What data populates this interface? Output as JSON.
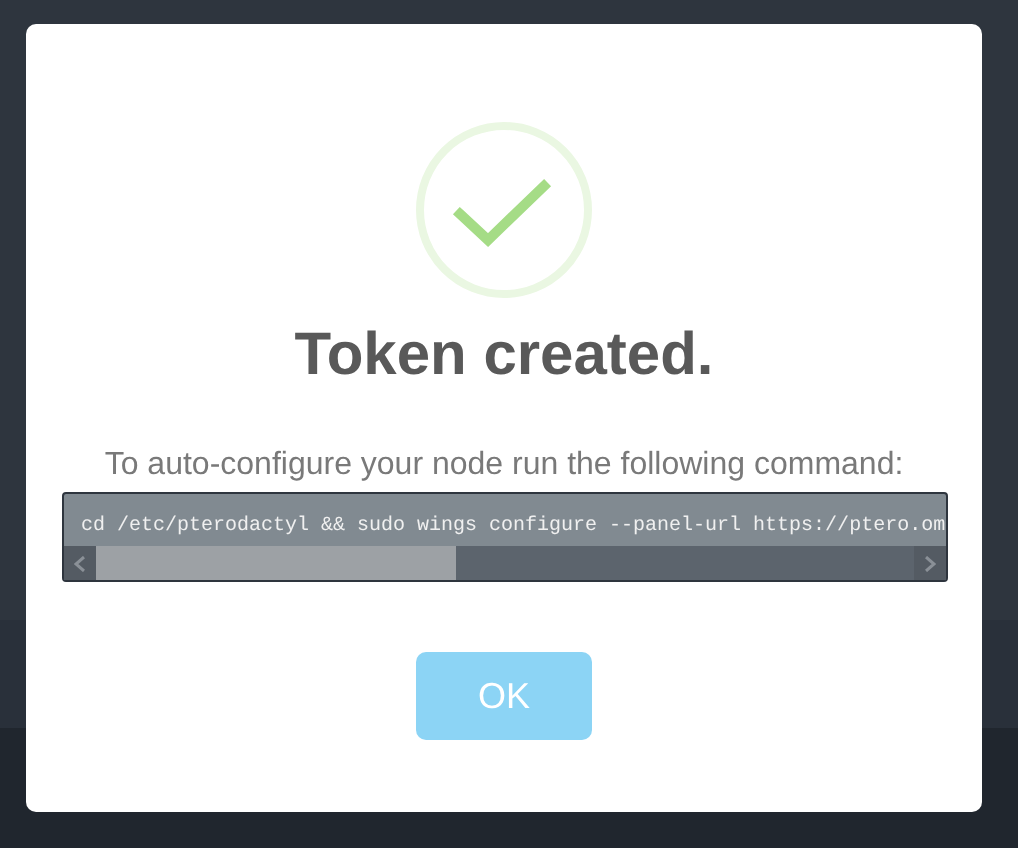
{
  "dialog": {
    "title": "Token created.",
    "message": "To auto-configure your node run the following command:",
    "command": "cd /etc/pterodactyl && sudo wings configure --panel-url https://ptero.om",
    "buttons": [
      {
        "label": "OK"
      }
    ]
  }
}
